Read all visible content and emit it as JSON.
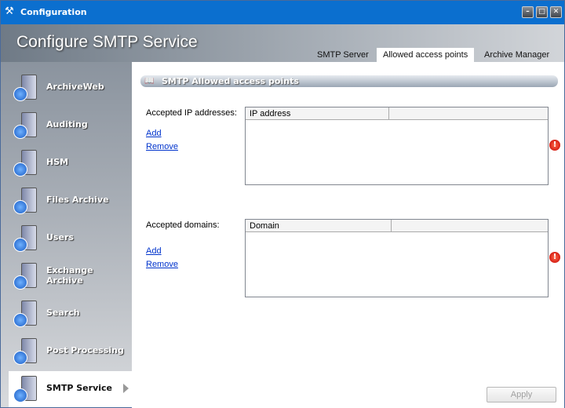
{
  "window": {
    "title": "Configuration",
    "icon": "tools-icon"
  },
  "header": {
    "title": "Configure SMTP Service"
  },
  "tabs": [
    {
      "label": "SMTP Server"
    },
    {
      "label": "Allowed access points",
      "active": true
    },
    {
      "label": "Archive Manager"
    }
  ],
  "sidebar": {
    "items": [
      {
        "label": "ArchiveWeb"
      },
      {
        "label": "Auditing"
      },
      {
        "label": "HSM"
      },
      {
        "label": "Files Archive"
      },
      {
        "label": "Users"
      },
      {
        "label": "Exchange Archive"
      },
      {
        "label": "Search"
      },
      {
        "label": "Post Processing"
      },
      {
        "label": "SMTP Service",
        "selected": true
      }
    ]
  },
  "section": {
    "title": "SMTP Allowed access points"
  },
  "ip": {
    "label": "Accepted IP addresses:",
    "column": "IP address",
    "add": "Add",
    "remove": "Remove",
    "rows": []
  },
  "domains": {
    "label": "Accepted domains:",
    "column": "Domain",
    "add": "Add",
    "remove": "Remove",
    "rows": []
  },
  "error_icon": "!",
  "apply": "Apply",
  "colors": {
    "titlebar": "#0b6fcf",
    "link": "#0033cc",
    "error": "#c40000"
  }
}
